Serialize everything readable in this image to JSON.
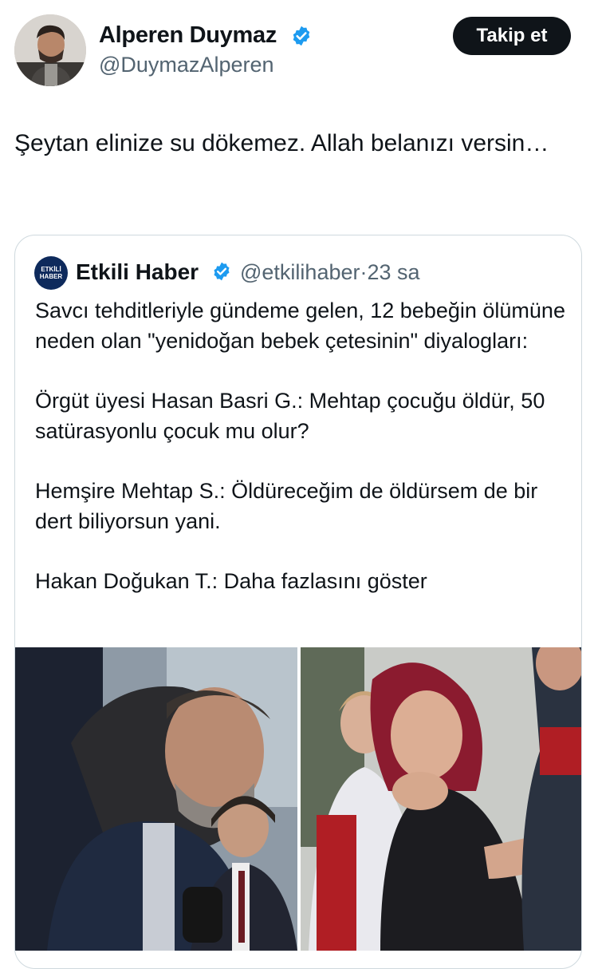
{
  "author": {
    "name": "Alperen Duymaz",
    "handle": "@DuymazAlperen",
    "verified_icon": "verified-badge-icon",
    "avatar": "profile-photo"
  },
  "follow_button": {
    "label": "Takip et"
  },
  "post": {
    "text": "Şeytan elinize su dökemez. Allah belanızı versin…"
  },
  "quoted": {
    "logo_text": "ETKİLİ HABER",
    "name": "Etkili Haber",
    "handle": "@etkilihaber",
    "separator": "·",
    "time": "23 sa",
    "paragraphs": [
      "Savcı tehditleriyle gündeme gelen, 12 bebeğin ölümüne neden olan \"yenidoğan bebek çetesinin\" diyalogları:",
      "Örgüt üyesi Hasan Basri G.: Mehtap çocuğu öldür, 50 satürasyonlu çocuk mu olur?",
      "Hemşire Mehtap S.: Öldüreceğim de öldürsem de bir dert biliyorsun yani.",
      "Hakan Doğukan T.: Daha fazlasını göster"
    ],
    "photos": [
      "news-photo-man",
      "news-photo-woman"
    ]
  },
  "colors": {
    "text": "#0f1419",
    "secondary": "#536471",
    "verified": "#1d9bf0",
    "border": "#cfd9de"
  }
}
